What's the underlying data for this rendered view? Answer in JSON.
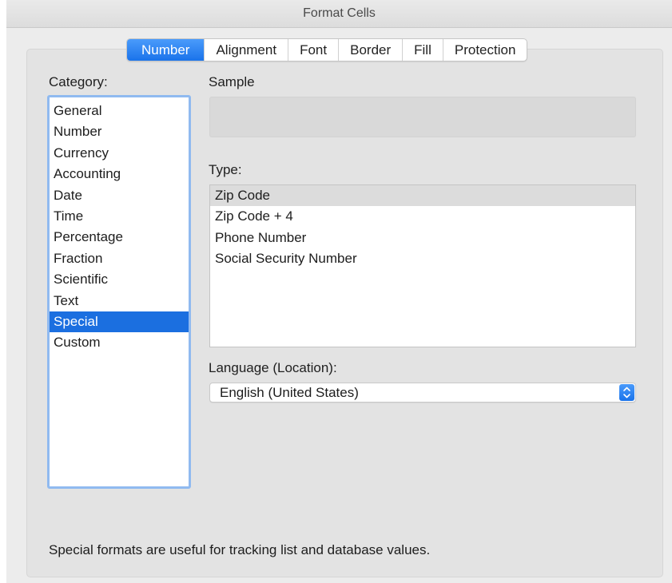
{
  "window": {
    "title": "Format Cells"
  },
  "tabs": [
    {
      "label": "Number",
      "active": true
    },
    {
      "label": "Alignment",
      "active": false
    },
    {
      "label": "Font",
      "active": false
    },
    {
      "label": "Border",
      "active": false
    },
    {
      "label": "Fill",
      "active": false
    },
    {
      "label": "Protection",
      "active": false
    }
  ],
  "category": {
    "label": "Category:",
    "items": [
      "General",
      "Number",
      "Currency",
      "Accounting",
      "Date",
      "Time",
      "Percentage",
      "Fraction",
      "Scientific",
      "Text",
      "Special",
      "Custom"
    ],
    "selected": "Special"
  },
  "sample": {
    "label": "Sample",
    "value": ""
  },
  "type": {
    "label": "Type:",
    "items": [
      "Zip Code",
      "Zip Code + 4",
      "Phone Number",
      "Social Security Number"
    ],
    "selected": "Zip Code"
  },
  "language": {
    "label": "Language (Location):",
    "value": "English (United States)",
    "icon": "chevron-up-down-icon"
  },
  "footer": {
    "description": "Special formats are useful for tracking list and database values."
  },
  "colors": {
    "accent": "#1b6fe0",
    "list_focus_border": "#90baf0",
    "window_bg": "#ececec",
    "pane_bg": "#e3e3e3"
  }
}
